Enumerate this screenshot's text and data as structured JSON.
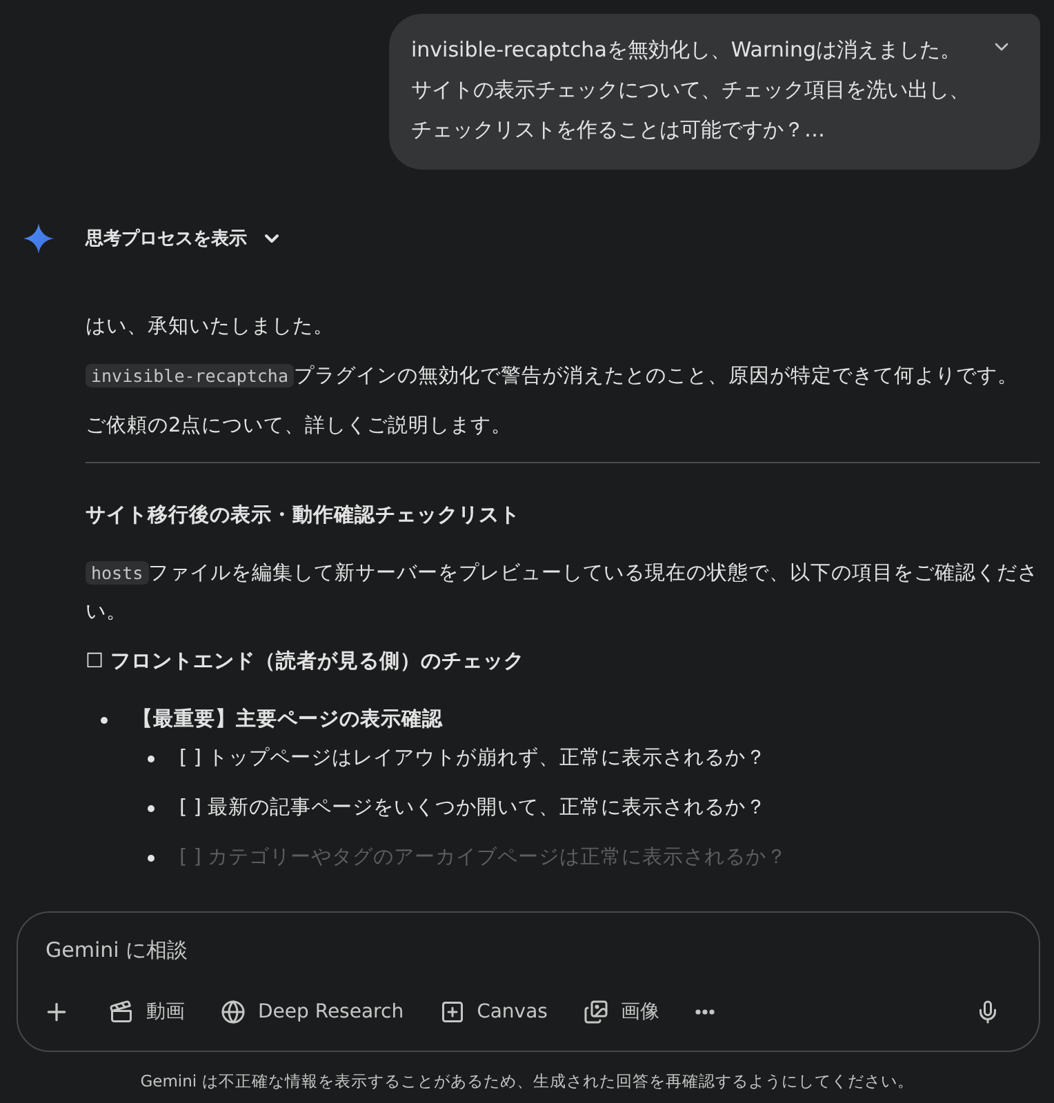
{
  "user_message": {
    "text": "invisible-recaptchaを無効化し、Warningは消えました。サイトの表示チェックについて、チェック項目を洗い出し、チェックリストを作ることは可能ですか？…",
    "expanded": false
  },
  "thoughts_toggle": {
    "label": "思考プロセスを表示",
    "expanded": false
  },
  "response": [
    {
      "kind": "paragraph",
      "segments": [
        {
          "kind": "text",
          "text": "はい、承知いたしました。"
        }
      ]
    },
    {
      "kind": "paragraph",
      "segments": [
        {
          "kind": "code",
          "text": "invisible-recaptcha"
        },
        {
          "kind": "text",
          "text": "プラグインの無効化で警告が消えたとのこと、原因が特定できて何よりです。"
        }
      ]
    },
    {
      "kind": "paragraph",
      "segments": [
        {
          "kind": "text",
          "text": "ご依頼の2点について、詳しくご説明します。"
        }
      ]
    },
    {
      "kind": "rule"
    },
    {
      "kind": "heading",
      "text": "サイト移行後の表示・動作確認チェックリスト"
    },
    {
      "kind": "paragraph",
      "segments": [
        {
          "kind": "code",
          "text": "hosts"
        },
        {
          "kind": "text",
          "text": "ファイルを編集して新サーバーをプレビューしている現在の状態で、以下の項目をご確認ください。"
        }
      ]
    },
    {
      "kind": "heading",
      "text": "☐ フロントエンド（読者が見る側）のチェック"
    },
    {
      "kind": "list",
      "items": [
        {
          "text": "【最重要】主要ページの表示確認",
          "bold": true,
          "faded": false,
          "children": [
            {
              "text": "[ ] トップページはレイアウトが崩れず、正常に表示されるか？",
              "bold": false,
              "faded": false
            },
            {
              "text": "[ ] 最新の記事ページをいくつか開いて、正常に表示されるか？",
              "bold": false,
              "faded": false
            },
            {
              "text": "[ ] カテゴリーやタグのアーカイブページは正常に表示されるか？",
              "bold": false,
              "faded": true
            }
          ]
        }
      ]
    }
  ],
  "composer": {
    "placeholder": "Gemini に相談",
    "tools": [
      {
        "kind": "video",
        "label": "動画"
      },
      {
        "kind": "research",
        "label": "Deep Research"
      },
      {
        "kind": "canvas",
        "label": "Canvas"
      },
      {
        "kind": "image",
        "label": "画像"
      }
    ]
  },
  "disclaimer": "Gemini は不正確な情報を表示することがあるため、生成された回答を再確認するようにしてください。"
}
